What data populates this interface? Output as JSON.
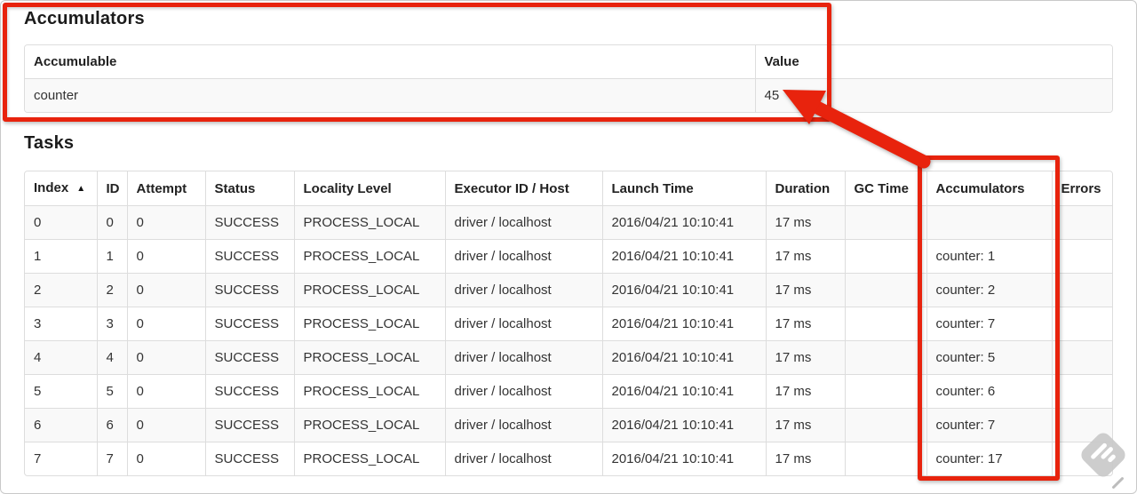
{
  "accumulators": {
    "title": "Accumulators",
    "headers": [
      "Accumulable",
      "Value"
    ],
    "rows": [
      {
        "name": "counter",
        "value": "45"
      }
    ]
  },
  "tasks": {
    "title": "Tasks",
    "sort_indicator": "▲",
    "headers": [
      "Index",
      "ID",
      "Attempt",
      "Status",
      "Locality Level",
      "Executor ID / Host",
      "Launch Time",
      "Duration",
      "GC Time",
      "Accumulators",
      "Errors"
    ],
    "rows": [
      {
        "index": "0",
        "id": "0",
        "attempt": "0",
        "status": "SUCCESS",
        "locality_level": "PROCESS_LOCAL",
        "executor_id_host": "driver / localhost",
        "launch_time": "2016/04/21 10:10:41",
        "duration": "17 ms",
        "gc_time": "",
        "accumulators": "",
        "errors": ""
      },
      {
        "index": "1",
        "id": "1",
        "attempt": "0",
        "status": "SUCCESS",
        "locality_level": "PROCESS_LOCAL",
        "executor_id_host": "driver / localhost",
        "launch_time": "2016/04/21 10:10:41",
        "duration": "17 ms",
        "gc_time": "",
        "accumulators": "counter: 1",
        "errors": ""
      },
      {
        "index": "2",
        "id": "2",
        "attempt": "0",
        "status": "SUCCESS",
        "locality_level": "PROCESS_LOCAL",
        "executor_id_host": "driver / localhost",
        "launch_time": "2016/04/21 10:10:41",
        "duration": "17 ms",
        "gc_time": "",
        "accumulators": "counter: 2",
        "errors": ""
      },
      {
        "index": "3",
        "id": "3",
        "attempt": "0",
        "status": "SUCCESS",
        "locality_level": "PROCESS_LOCAL",
        "executor_id_host": "driver / localhost",
        "launch_time": "2016/04/21 10:10:41",
        "duration": "17 ms",
        "gc_time": "",
        "accumulators": "counter: 7",
        "errors": ""
      },
      {
        "index": "4",
        "id": "4",
        "attempt": "0",
        "status": "SUCCESS",
        "locality_level": "PROCESS_LOCAL",
        "executor_id_host": "driver / localhost",
        "launch_time": "2016/04/21 10:10:41",
        "duration": "17 ms",
        "gc_time": "",
        "accumulators": "counter: 5",
        "errors": ""
      },
      {
        "index": "5",
        "id": "5",
        "attempt": "0",
        "status": "SUCCESS",
        "locality_level": "PROCESS_LOCAL",
        "executor_id_host": "driver / localhost",
        "launch_time": "2016/04/21 10:10:41",
        "duration": "17 ms",
        "gc_time": "",
        "accumulators": "counter: 6",
        "errors": ""
      },
      {
        "index": "6",
        "id": "6",
        "attempt": "0",
        "status": "SUCCESS",
        "locality_level": "PROCESS_LOCAL",
        "executor_id_host": "driver / localhost",
        "launch_time": "2016/04/21 10:10:41",
        "duration": "17 ms",
        "gc_time": "",
        "accumulators": "counter: 7",
        "errors": ""
      },
      {
        "index": "7",
        "id": "7",
        "attempt": "0",
        "status": "SUCCESS",
        "locality_level": "PROCESS_LOCAL",
        "executor_id_host": "driver / localhost",
        "launch_time": "2016/04/21 10:10:41",
        "duration": "17 ms",
        "gc_time": "",
        "accumulators": "counter: 17",
        "errors": ""
      }
    ]
  },
  "annotations": {
    "accent_color": "#e8230d",
    "box_1_target": "accumulators-summary-table",
    "box_2_target": "accumulators-column",
    "arrow_points_to": "45"
  },
  "icons": {
    "sort": "sort-ascending-icon",
    "watermark": "skitch-feather-icon"
  }
}
